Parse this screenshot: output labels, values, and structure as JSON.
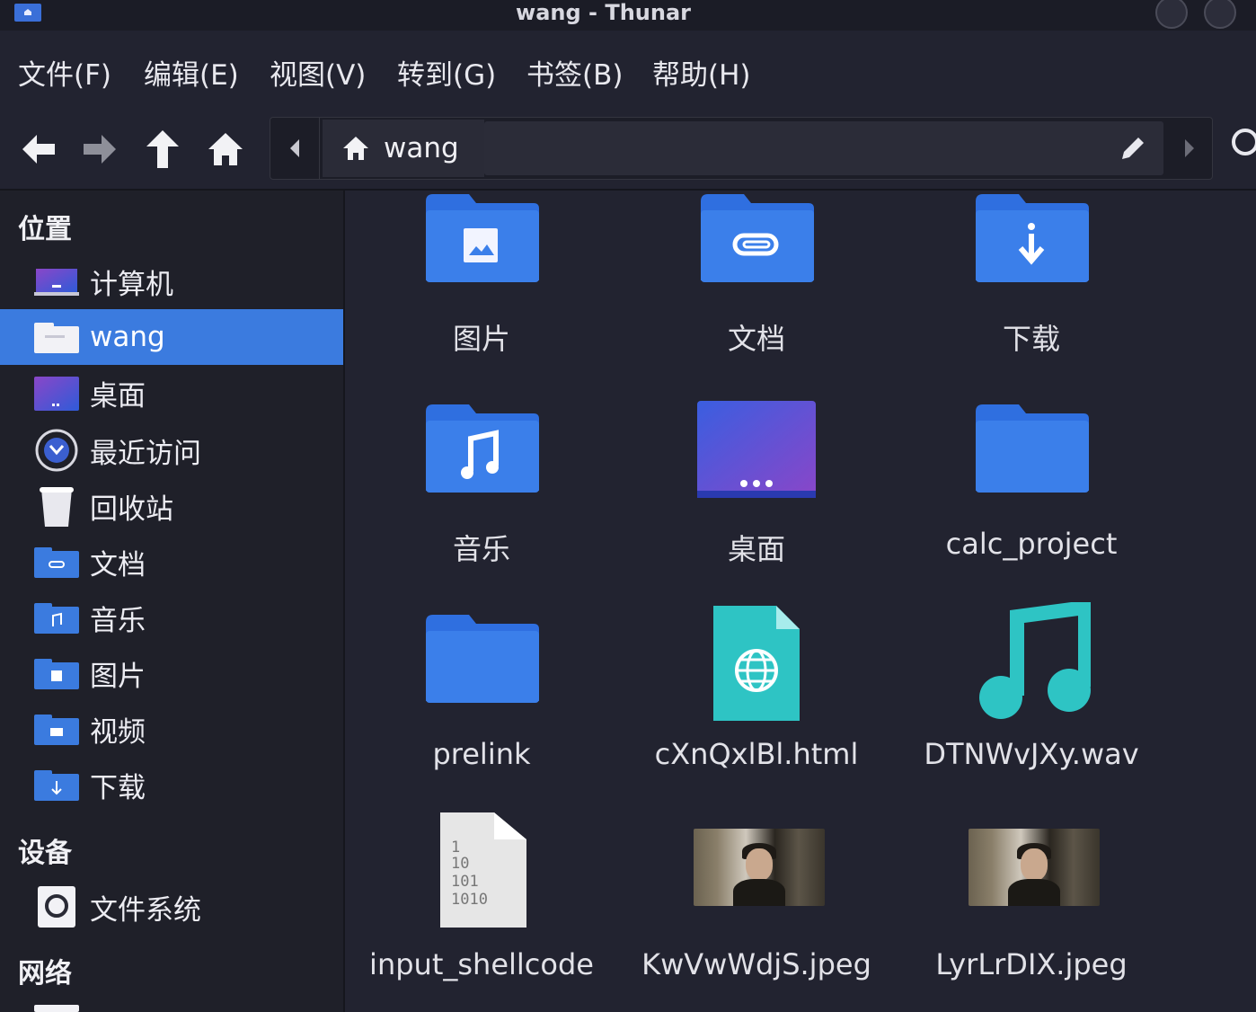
{
  "window": {
    "title": "wang - Thunar"
  },
  "menu": [
    "文件(F)",
    "编辑(E)",
    "视图(V)",
    "转到(G)",
    "书签(B)",
    "帮助(H)"
  ],
  "toolbar": {
    "path_crumb": "wang",
    "icons": [
      "back-arrow-icon",
      "forward-arrow-icon",
      "up-arrow-icon",
      "home-icon",
      "pencil-icon",
      "search-icon"
    ]
  },
  "sidebar": {
    "places_header": "位置",
    "places": [
      {
        "label": "计算机",
        "icon": "computer-icon"
      },
      {
        "label": "wang",
        "icon": "home-folder-icon",
        "active": true
      },
      {
        "label": "桌面",
        "icon": "desktop-icon"
      },
      {
        "label": "最近访问",
        "icon": "recent-icon"
      },
      {
        "label": "回收站",
        "icon": "trash-icon"
      },
      {
        "label": "文档",
        "icon": "documents-folder-icon"
      },
      {
        "label": "音乐",
        "icon": "music-folder-icon"
      },
      {
        "label": "图片",
        "icon": "pictures-folder-icon"
      },
      {
        "label": "视频",
        "icon": "videos-folder-icon"
      },
      {
        "label": "下载",
        "icon": "downloads-folder-icon"
      }
    ],
    "devices_header": "设备",
    "devices": [
      {
        "label": "文件系统",
        "icon": "drive-icon"
      }
    ],
    "network_header": "网络"
  },
  "files": [
    {
      "name": "图片",
      "icon": "pictures-folder-icon"
    },
    {
      "name": "文档",
      "icon": "documents-folder-icon"
    },
    {
      "name": "下载",
      "icon": "downloads-folder-icon"
    },
    {
      "name": "音乐",
      "icon": "music-folder-icon"
    },
    {
      "name": "桌面",
      "icon": "desktop-folder-icon"
    },
    {
      "name": "calc_project",
      "icon": "folder-icon"
    },
    {
      "name": "prelink",
      "icon": "folder-icon"
    },
    {
      "name": "cXnQxlBl.html",
      "icon": "html-file-icon"
    },
    {
      "name": "DTNWvJXy.wav",
      "icon": "audio-file-icon"
    },
    {
      "name": "input_shellcode",
      "icon": "binary-file-icon"
    },
    {
      "name": "KwVwWdjS.jpeg",
      "icon": "image-thumbnail"
    },
    {
      "name": "LyrLrDIX.jpeg",
      "icon": "image-thumbnail"
    }
  ],
  "colors": {
    "accent": "#3b7bdf",
    "folder": "#3b7bdf",
    "teal": "#2ec4c4",
    "background": "#222330"
  }
}
